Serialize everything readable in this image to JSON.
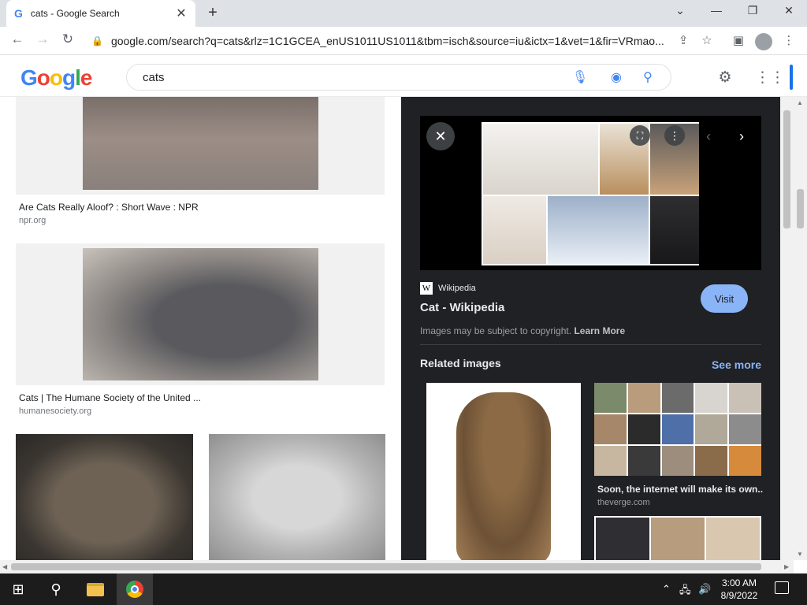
{
  "browser": {
    "tab_title": "cats - Google Search",
    "tab_favicon": "G",
    "url": "google.com/search?q=cats&rlz=1C1GCEA_enUS1011US1011&tbm=isch&source=iu&ictx=1&vet=1&fir=VRmao..."
  },
  "header": {
    "logo_letters": [
      "G",
      "o",
      "o",
      "g",
      "l",
      "e"
    ],
    "logo_colors": [
      "#4285f4",
      "#ea4335",
      "#fbbc05",
      "#4285f4",
      "#34a853",
      "#ea4335"
    ],
    "search_value": "cats"
  },
  "results": [
    {
      "title": "Are Cats Really Aloof? : Short Wave : NPR",
      "source": "npr.org"
    },
    {
      "title": "Cats | The Humane Society of the United ...",
      "source": "humanesociety.org"
    }
  ],
  "panel": {
    "source_badge": "W",
    "source_name": "Wikipedia",
    "title": "Cat - Wikipedia",
    "visit_label": "Visit",
    "copyright_text": "Images may be subject to copyright.",
    "learn_more": "Learn More",
    "related_heading": "Related images",
    "see_more": "See more",
    "related_caption": "Soon, the internet will make its own...",
    "related_source": "theverge.com"
  },
  "taskbar": {
    "time": "3:00 AM",
    "date": "8/9/2022"
  },
  "colors": {
    "accent_blue": "#1a73e8",
    "panel_bg": "#202124",
    "visit_bg": "#8ab4f8"
  }
}
